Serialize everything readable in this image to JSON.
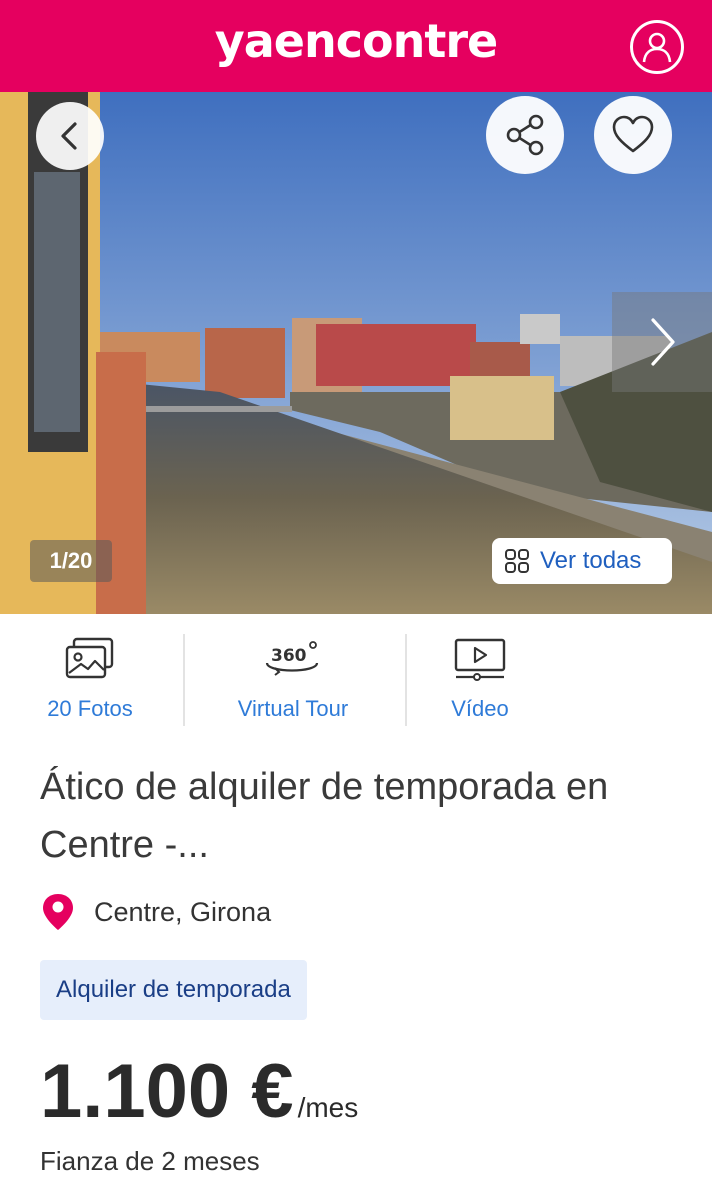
{
  "header": {
    "logo": "yaencontre",
    "user_icon": "user-icon",
    "brand_color": "#e5005f"
  },
  "gallery": {
    "counter": "1/20",
    "see_all_label": "Ver todas",
    "back_icon": "chevron-left-icon",
    "share_icon": "share-icon",
    "favorite_icon": "heart-icon",
    "next_icon": "chevron-right-icon",
    "grid_icon": "grid-icon"
  },
  "media_tabs": [
    {
      "label": "20 Fotos",
      "icon": "photos-icon"
    },
    {
      "label": "Virtual Tour",
      "icon": "360-icon"
    },
    {
      "label": "Vídeo",
      "icon": "video-icon"
    }
  ],
  "tour_icon_text": "360",
  "listing": {
    "title": "Ático de alquiler de temporada en Centre -...",
    "location": "Centre, Girona",
    "location_icon": "map-pin-icon",
    "badge": "Alquiler de temporada",
    "price": "1.100 €",
    "price_unit": "/mes",
    "deposit": "Fianza de 2 meses"
  },
  "colors": {
    "accent_blue": "#2f7bd8",
    "badge_bg": "#e6eefb",
    "badge_text": "#1a3e86"
  }
}
